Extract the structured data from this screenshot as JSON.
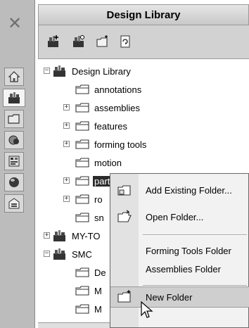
{
  "window": {
    "close_glyph": "✕",
    "title": "Design Library"
  },
  "toolbar": {
    "buttons": [
      {
        "icon": "add-to-library-icon"
      },
      {
        "icon": "add-location-icon"
      },
      {
        "icon": "create-new-folder-icon"
      },
      {
        "icon": "refresh-icon"
      }
    ]
  },
  "side_tabs": [
    {
      "icon": "home-icon"
    },
    {
      "icon": "design-library-icon",
      "active": true
    },
    {
      "icon": "file-explorer-icon"
    },
    {
      "icon": "view-palette-icon"
    },
    {
      "icon": "appearances-icon"
    },
    {
      "icon": "custom-properties-icon"
    },
    {
      "icon": "document-properties-icon"
    }
  ],
  "tree": {
    "nodes": [
      {
        "label": "Design Library",
        "icon": "library-icon",
        "expander": "−"
      },
      {
        "label": "annotations",
        "icon": "folder-icon"
      },
      {
        "label": "assemblies",
        "icon": "folder-icon",
        "expander": "+"
      },
      {
        "label": "features",
        "icon": "folder-icon",
        "expander": "+"
      },
      {
        "label": "forming tools",
        "icon": "folder-icon",
        "expander": "+"
      },
      {
        "label": "motion",
        "icon": "folder-icon"
      },
      {
        "label": "parts",
        "icon": "folder-icon",
        "expander": "+",
        "selected": true
      },
      {
        "label": "ro",
        "icon": "folder-icon",
        "expander": "+"
      },
      {
        "label": "sn",
        "icon": "folder-icon"
      },
      {
        "label": "MY-TO",
        "icon": "library-icon",
        "expander": "+"
      },
      {
        "label": "SMC",
        "icon": "library-icon",
        "expander": "−"
      },
      {
        "label": "De",
        "icon": "folder-icon"
      },
      {
        "label": "M",
        "icon": "folder-icon"
      },
      {
        "label": "M",
        "icon": "folder-icon"
      }
    ]
  },
  "context_menu": {
    "items": [
      {
        "label": "Add Existing Folder...",
        "icon": "add-existing-folder-icon"
      },
      {
        "label": "Open Folder...",
        "icon": "open-folder-icon"
      },
      {
        "label": "Forming Tools Folder",
        "icon": ""
      },
      {
        "label": "Assemblies Folder",
        "icon": ""
      },
      {
        "label": "New Folder",
        "icon": "new-folder-icon",
        "hover": true
      }
    ]
  },
  "colors": {
    "selection": "#2b2b2b",
    "menu_hover": "#cfcfcf",
    "strip": "#bcbcbc"
  }
}
